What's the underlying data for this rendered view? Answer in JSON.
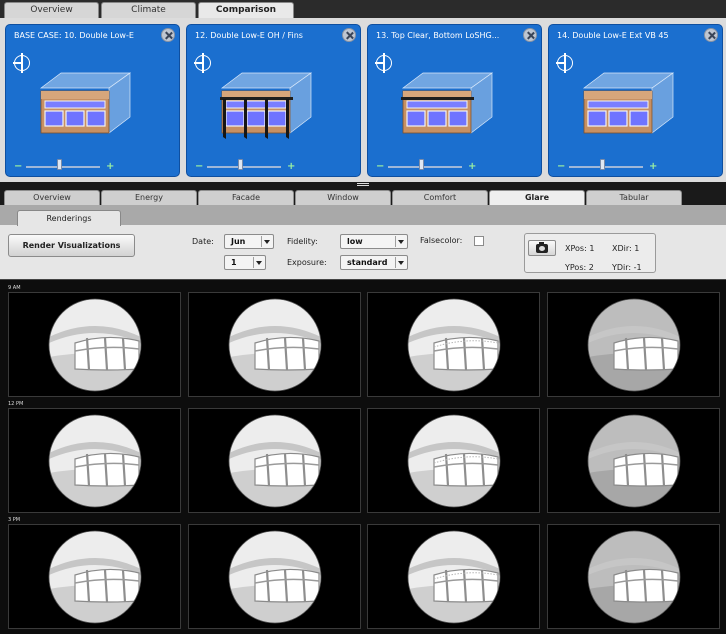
{
  "top_tabs": [
    "Overview",
    "Climate",
    "Comparison"
  ],
  "active_top_tab": "Comparison",
  "cases": [
    {
      "title": "BASE CASE: 10. Double Low-E",
      "shading": "none"
    },
    {
      "title": "12. Double Low-E OH / Fins",
      "shading": "fins"
    },
    {
      "title": "13. Top Clear, Bottom LoSHG...",
      "shading": "overhang"
    },
    {
      "title": "14. Double Low-E Ext VB 45",
      "shading": "none"
    }
  ],
  "zoom": {
    "minus": "−",
    "plus": "+",
    "level": 0.45
  },
  "sub_tabs": [
    "Overview",
    "Energy",
    "Facade",
    "Window",
    "Comfort",
    "Glare",
    "Tabular"
  ],
  "active_sub_tab": "Glare",
  "glare": {
    "subtab": "Renderings",
    "render_button": "Render Visualizations",
    "date_label": "Date:",
    "month": "Jun",
    "day": "1",
    "fidelity_label": "Fidelity:",
    "fidelity": "low",
    "exposure_label": "Exposure:",
    "exposure": "standard",
    "falsecolor_label": "Falsecolor:",
    "falsecolor_checked": false,
    "xpos_label": "XPos:",
    "xpos": "1",
    "ypos_label": "YPos:",
    "ypos": "2",
    "xdir_label": "XDir:",
    "xdir": "1",
    "ydir_label": "YDir:",
    "ydir": "-1"
  },
  "time_rows": [
    "9 AM",
    "12 PM",
    "3 PM"
  ]
}
